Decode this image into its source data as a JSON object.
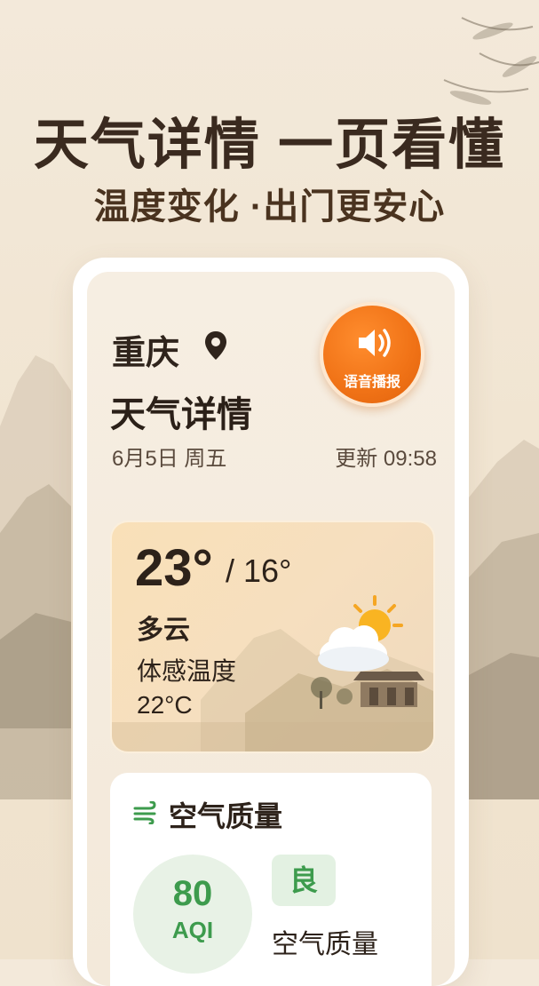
{
  "headline": {
    "main": "天气详情 一页看懂",
    "sub": "温度变化 ·出门更安心"
  },
  "header": {
    "city": "重庆",
    "location_icon": "location-pin-icon",
    "title": "天气详情",
    "date": "6月5日 周五",
    "update": "更新 09:58"
  },
  "voice_button": {
    "label": "语音播报",
    "icon": "speaker-icon",
    "color": "#f07216"
  },
  "weather": {
    "temp_high": "23°",
    "temp_low": "/ 16°",
    "condition": "多云",
    "feels_label": "体感温度",
    "feels_value": "22°C",
    "icon": "partly-cloudy-icon"
  },
  "air_quality": {
    "title": "空气质量",
    "icon": "wind-icon",
    "aqi_value": "80",
    "aqi_unit": "AQI",
    "grade": "良",
    "sub_label": "空气质量",
    "accent": "#3d9b4d"
  }
}
